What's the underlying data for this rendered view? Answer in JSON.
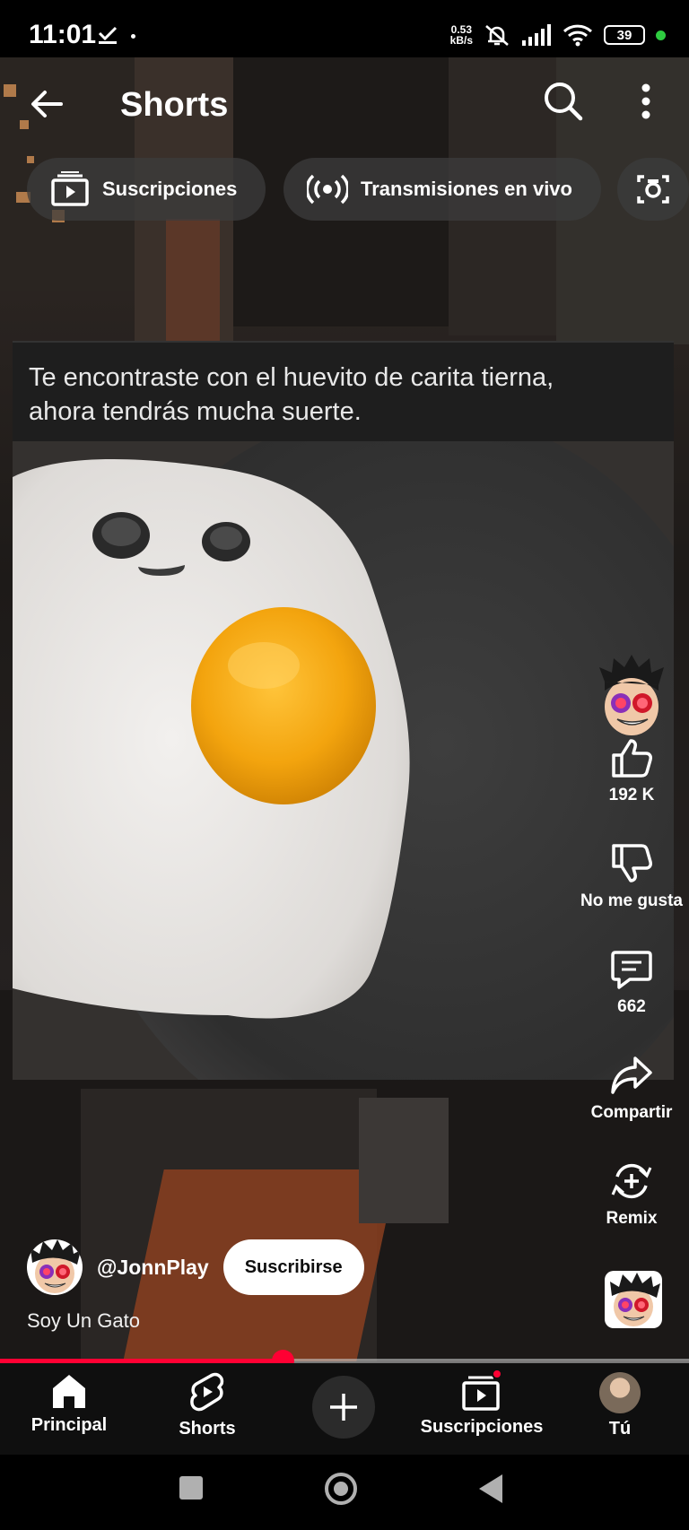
{
  "status_bar": {
    "time": "11:01",
    "net_speed_value": "0.53",
    "net_speed_unit": "kB/s",
    "battery": "39"
  },
  "header": {
    "title": "Shorts"
  },
  "chips": [
    {
      "label": "Suscripciones",
      "icon": "subscriptions-icon"
    },
    {
      "label": "Transmisiones en vivo",
      "icon": "live-broadcast-icon"
    },
    {
      "label": "",
      "icon": "camera-icon"
    }
  ],
  "video": {
    "caption_line1": "Te encontraste con el huevito de carita tierna,",
    "caption_line2": "ahora tendrás mucha suerte.",
    "channel_handle": "@JonnPlay",
    "subscribe_label": "Suscribirse",
    "title": "Soy Un Gato",
    "progress": 0.41
  },
  "actions": {
    "likes": "192 K",
    "dislike_label": "No me gusta",
    "comments": "662",
    "share_label": "Compartir",
    "remix_label": "Remix"
  },
  "bottom_nav": [
    {
      "label": "Principal",
      "icon": "home-icon"
    },
    {
      "label": "Shorts",
      "icon": "shorts-icon"
    },
    {
      "label": "",
      "icon": "create-plus-icon"
    },
    {
      "label": "Suscripciones",
      "icon": "subscriptions-icon"
    },
    {
      "label": "Tú",
      "icon": "avatar"
    }
  ],
  "colors": {
    "accent": "#ff0033",
    "background": "#0f0f0f",
    "battery_dot": "#2ecc40"
  }
}
